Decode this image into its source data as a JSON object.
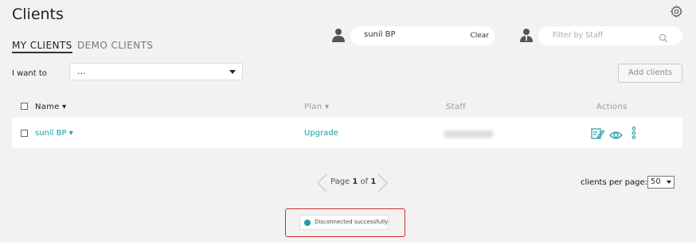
{
  "page": {
    "title": "Clients"
  },
  "tabs": [
    {
      "label": "MY CLIENTS",
      "active": true
    },
    {
      "label": "DEMO CLIENTS",
      "active": false
    }
  ],
  "search": {
    "value": "sunil BP",
    "clear_label": "Clear"
  },
  "staff_filter": {
    "placeholder": "Filter by Staff"
  },
  "actions_bar": {
    "i_want_to_label": "I want to",
    "select_value": "...",
    "add_clients_label": "Add clients"
  },
  "table": {
    "headers": {
      "name": "Name ▾",
      "plan": "Plan ▾",
      "staff": "Staff",
      "actions": "Actions"
    },
    "rows": [
      {
        "name": "sunil BP ▾",
        "plan": "Upgrade"
      }
    ]
  },
  "pagination": {
    "prefix": "Page ",
    "current": "1",
    "sep": " of ",
    "total": "1"
  },
  "per_page": {
    "label": "clients per page:",
    "value": "50"
  },
  "toast": {
    "message": "Disconnected successfully"
  },
  "colors": {
    "accent": "#1a9ea6",
    "highlight": "#d9262b"
  },
  "icons": [
    "gear-icon",
    "user-icon",
    "staff-icon",
    "search-icon",
    "edit-note-icon",
    "eye-icon",
    "more-vertical-icon",
    "chevron-left-icon",
    "chevron-right-icon",
    "check-circle-icon"
  ]
}
